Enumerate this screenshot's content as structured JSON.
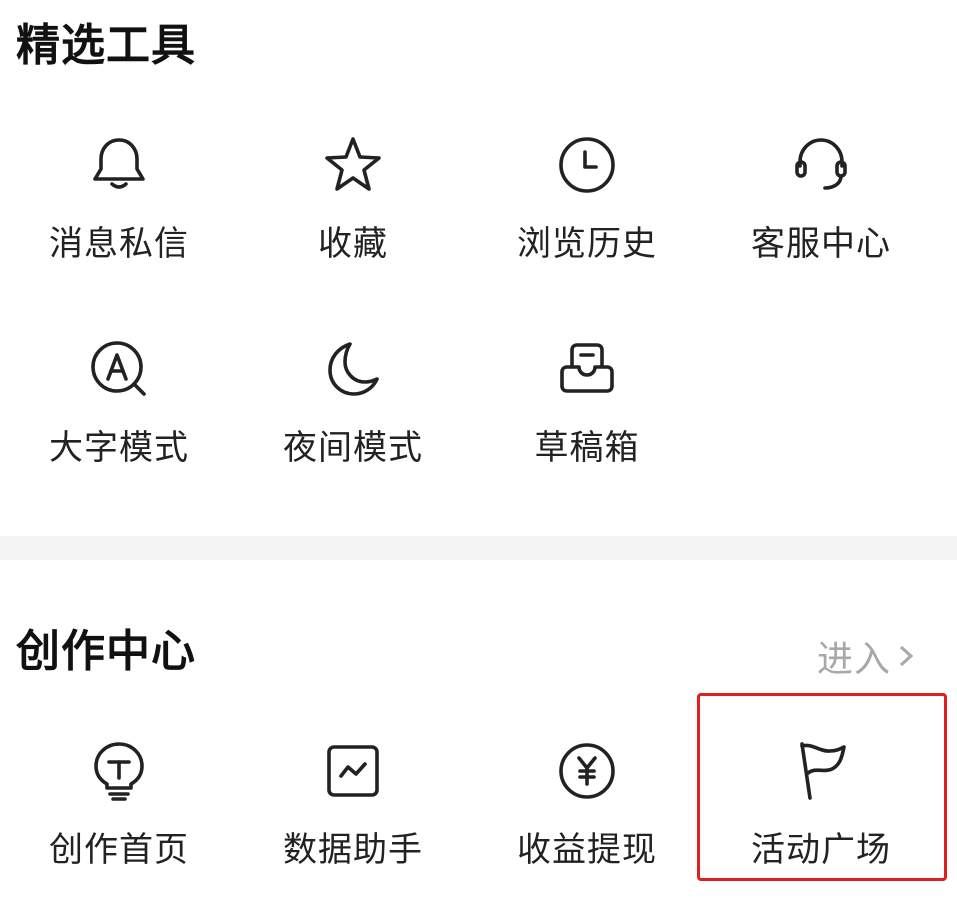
{
  "selected_tools": {
    "title": "精选工具",
    "items": [
      {
        "label": "消息私信",
        "icon": "bell-icon"
      },
      {
        "label": "收藏",
        "icon": "star-icon"
      },
      {
        "label": "浏览历史",
        "icon": "clock-icon"
      },
      {
        "label": "客服中心",
        "icon": "headset-icon"
      },
      {
        "label": "大字模式",
        "icon": "large-font-icon"
      },
      {
        "label": "夜间模式",
        "icon": "moon-icon"
      },
      {
        "label": "草稿箱",
        "icon": "inbox-icon"
      }
    ]
  },
  "creation_center": {
    "title": "创作中心",
    "enter_label": "进入",
    "items": [
      {
        "label": "创作首页",
        "icon": "lightbulb-icon"
      },
      {
        "label": "数据助手",
        "icon": "chart-icon"
      },
      {
        "label": "收益提现",
        "icon": "yen-icon"
      },
      {
        "label": "活动广场",
        "icon": "flag-icon"
      }
    ]
  },
  "colors": {
    "highlight": "#e02020",
    "muted": "#a8a8a8"
  }
}
